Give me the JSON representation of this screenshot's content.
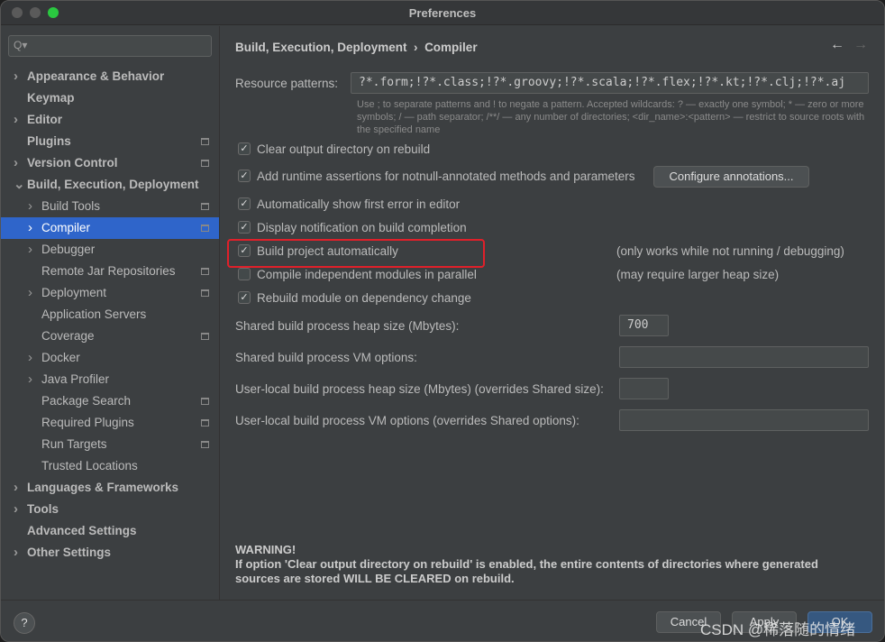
{
  "window": {
    "title": "Preferences"
  },
  "sidebar": {
    "search_placeholder": "Q▾",
    "items": [
      {
        "label": "Appearance & Behavior",
        "bold": true,
        "arrow": true,
        "level": 0
      },
      {
        "label": "Keymap",
        "bold": true,
        "arrow": false,
        "level": 0
      },
      {
        "label": "Editor",
        "bold": true,
        "arrow": true,
        "level": 0
      },
      {
        "label": "Plugins",
        "bold": true,
        "arrow": false,
        "level": 0,
        "icon": true
      },
      {
        "label": "Version Control",
        "bold": true,
        "arrow": true,
        "level": 0,
        "icon": true
      },
      {
        "label": "Build, Execution, Deployment",
        "bold": true,
        "arrow": "open",
        "level": 0
      },
      {
        "label": "Build Tools",
        "arrow": true,
        "level": 1,
        "icon": true
      },
      {
        "label": "Compiler",
        "arrow": true,
        "level": 1,
        "icon": true,
        "selected": true
      },
      {
        "label": "Debugger",
        "arrow": true,
        "level": 1
      },
      {
        "label": "Remote Jar Repositories",
        "level": 1,
        "icon": true
      },
      {
        "label": "Deployment",
        "arrow": true,
        "level": 1,
        "icon": true
      },
      {
        "label": "Application Servers",
        "level": 1
      },
      {
        "label": "Coverage",
        "level": 1,
        "icon": true
      },
      {
        "label": "Docker",
        "arrow": true,
        "level": 1
      },
      {
        "label": "Java Profiler",
        "arrow": true,
        "level": 1
      },
      {
        "label": "Package Search",
        "level": 1,
        "icon": true
      },
      {
        "label": "Required Plugins",
        "level": 1,
        "icon": true
      },
      {
        "label": "Run Targets",
        "level": 1,
        "icon": true
      },
      {
        "label": "Trusted Locations",
        "level": 1
      },
      {
        "label": "Languages & Frameworks",
        "bold": true,
        "arrow": true,
        "level": 0
      },
      {
        "label": "Tools",
        "bold": true,
        "arrow": true,
        "level": 0
      },
      {
        "label": "Advanced Settings",
        "bold": true,
        "level": 0
      },
      {
        "label": "Other Settings",
        "bold": true,
        "arrow": true,
        "level": 0
      }
    ]
  },
  "main": {
    "breadcrumb": {
      "parent": "Build, Execution, Deployment",
      "sep": "›",
      "current": "Compiler"
    },
    "resource_label": "Resource patterns:",
    "resource_value": "?*.form;!?*.class;!?*.groovy;!?*.scala;!?*.flex;!?*.kt;!?*.clj;!?*.aj",
    "hint": "Use ; to separate patterns and ! to negate a pattern. Accepted wildcards: ? — exactly one symbol; * — zero or more symbols; / — path separator; /**/ — any number of directories; <dir_name>:<pattern> — restrict to source roots with the specified name",
    "checkboxes": [
      {
        "label": "Clear output directory on rebuild",
        "checked": true
      },
      {
        "label": "Add runtime assertions for notnull-annotated methods and parameters",
        "checked": true
      },
      {
        "label": "Automatically show first error in editor",
        "checked": true
      },
      {
        "label": "Display notification on build completion",
        "checked": true
      },
      {
        "label": "Build project automatically",
        "checked": true
      },
      {
        "label": "Compile independent modules in parallel",
        "checked": false
      },
      {
        "label": "Rebuild module on dependency change",
        "checked": true
      }
    ],
    "configure_button": "Configure annotations...",
    "note_auto": "(only works while not running / debugging)",
    "note_parallel": "(may require larger heap size)",
    "heap_label": "Shared build process heap size (Mbytes):",
    "heap_value": "700",
    "vm_label": "Shared build process VM options:",
    "user_heap_label": "User-local build process heap size (Mbytes) (overrides Shared size):",
    "user_vm_label": "User-local build process VM options (overrides Shared options):",
    "warning_title": "WARNING!",
    "warning_text": "If option 'Clear output directory on rebuild' is enabled, the entire contents of directories where generated sources are stored WILL BE CLEARED on rebuild."
  },
  "footer": {
    "help": "?",
    "cancel": "Cancel",
    "apply": "Apply",
    "ok": "OK",
    "watermark": "CSDN @稀落随的情绪"
  },
  "colors": {
    "selection": "#2f65ca",
    "highlight_box": "#e0202a"
  }
}
